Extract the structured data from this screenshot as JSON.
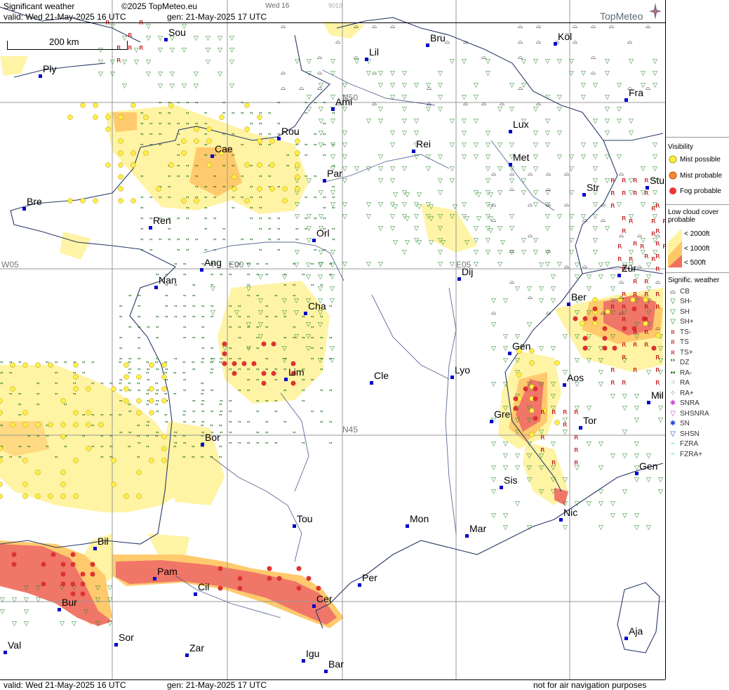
{
  "header": {
    "title": "Significant weather",
    "copyright": "©2025 TopMeteo.eu",
    "valid": "valid:  Wed  21-May-2025  16 UTC",
    "gen": "gen: 21-May-2025 17 UTC",
    "frame_label": "Wed 16",
    "frame_code": "9010",
    "brand": "TopMeteo"
  },
  "scale": "200 km",
  "grid_labels": [
    "N50",
    "N45",
    "W05",
    "E00",
    "E05"
  ],
  "cities": [
    "Sou",
    "Bru",
    "Köl",
    "Lil",
    "Ply",
    "Ami",
    "Fra",
    "Lux",
    "Rou",
    "Cae",
    "Rei",
    "Met",
    "Par",
    "Stu",
    "Bre",
    "Str",
    "Ren",
    "Orl",
    "Zür",
    "Ang",
    "Dij",
    "Nan",
    "Ber",
    "Cha",
    "Gen",
    "Lim",
    "Cle",
    "Lyo",
    "Aos",
    "Mil",
    "Gre",
    "Tor",
    "Bor",
    "Gen",
    "Sis",
    "Nic",
    "Tou",
    "Mon",
    "Mar",
    "Bil",
    "Pam",
    "Cil",
    "Per",
    "Cer",
    "Bur",
    "Sor",
    "Val",
    "Zar",
    "Aja",
    "Igu",
    "Bar"
  ],
  "legend": {
    "visibility_title": "Visibility",
    "visibility": [
      {
        "label": "Mist possible",
        "color": "#ffee44"
      },
      {
        "label": "Mist probable",
        "color": "#ff8833"
      },
      {
        "label": "Fog probable",
        "color": "#ee3333"
      }
    ],
    "cloud_title": "Low cloud cover probable",
    "cloud": [
      {
        "label": "<  2000ft",
        "color": "#fff3a0"
      },
      {
        "label": "< 1000ft",
        "color": "#ffc866"
      },
      {
        "label": "<   500ft",
        "color": "#f07060"
      }
    ],
    "weather_title": "Signific. weather",
    "weather": [
      {
        "label": "CB",
        "icon": "cb-icon",
        "glyph": "⌓",
        "color": "#000"
      },
      {
        "label": "SH-",
        "icon": "shower-light-icon",
        "glyph": "▽",
        "color": "#228822"
      },
      {
        "label": "SH",
        "icon": "shower-icon",
        "glyph": "▽",
        "color": "#228822"
      },
      {
        "label": "SH+",
        "icon": "shower-heavy-icon",
        "glyph": "▽",
        "color": "#228822"
      },
      {
        "label": "TS-",
        "icon": "thunderstorm-light-icon",
        "glyph": "ʀ",
        "color": "#bb1111"
      },
      {
        "label": "TS",
        "icon": "thunderstorm-icon",
        "glyph": "ʀ",
        "color": "#bb1111"
      },
      {
        "label": "TS+",
        "icon": "thunderstorm-heavy-icon",
        "glyph": "ʀ",
        "color": "#bb1111"
      },
      {
        "label": "DZ",
        "icon": "drizzle-icon",
        "glyph": "❜❜",
        "color": "#116611"
      },
      {
        "label": "RA-",
        "icon": "rain-light-icon",
        "glyph": "••",
        "color": "#116611"
      },
      {
        "label": "RA",
        "icon": "rain-icon",
        "glyph": "⁖",
        "color": "#116611"
      },
      {
        "label": "RA+",
        "icon": "rain-heavy-icon",
        "glyph": "⁘",
        "color": "#116611"
      },
      {
        "label": "SNRA",
        "icon": "snow-rain-icon",
        "glyph": "✱",
        "color": "#cc44cc"
      },
      {
        "label": "SHSNRA",
        "icon": "snow-rain-shower-icon",
        "glyph": "▽",
        "color": "#cc44cc"
      },
      {
        "label": "SN",
        "icon": "snow-icon",
        "glyph": "✱",
        "color": "#2244cc"
      },
      {
        "label": "SHSN",
        "icon": "snow-shower-icon",
        "glyph": "▽",
        "color": "#2244cc"
      },
      {
        "label": "FZRA",
        "icon": "freezing-rain-icon",
        "glyph": "~",
        "color": "#22bbdd"
      },
      {
        "label": "FZRA+",
        "icon": "freezing-rain-heavy-icon",
        "glyph": "~",
        "color": "#22bbdd"
      }
    ]
  },
  "footer": {
    "valid": "valid:  Wed  21-May-2025  16 UTC",
    "gen": "gen: 21-May-2025 17 UTC",
    "disclaimer": "not for air navigation purposes"
  }
}
